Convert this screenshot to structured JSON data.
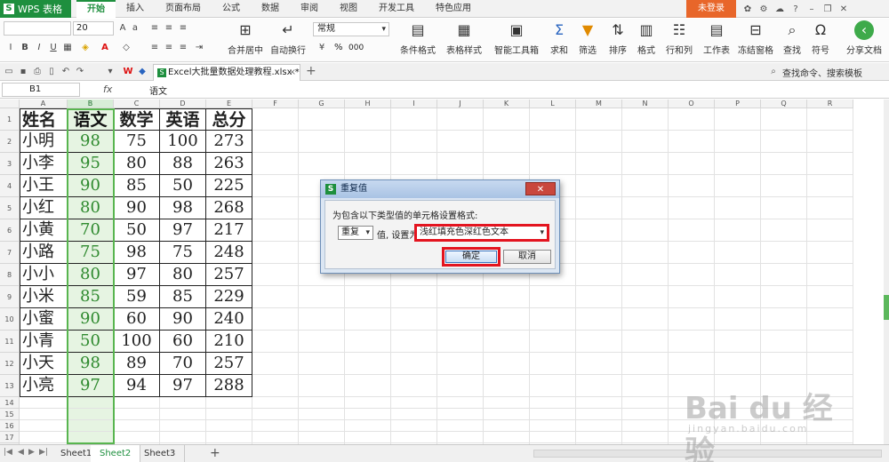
{
  "titlebar": {
    "app_name": "WPS 表格",
    "tabs": [
      "开始",
      "插入",
      "页面布局",
      "公式",
      "数据",
      "审阅",
      "视图",
      "开发工具",
      "特色应用"
    ],
    "active_tab": "开始",
    "login": "未登录"
  },
  "ribbon": {
    "font_name": "",
    "font_size": "20",
    "number_format": "常规",
    "merge_center": "合并居中",
    "auto_wrap": "自动换行",
    "percent": "%",
    "comma": "000",
    "cond_format": "条件格式",
    "table_style": "表格样式",
    "smart_toolbox": "智能工具箱",
    "sum": "求和",
    "filter": "筛选",
    "sort": "排序",
    "format": "格式",
    "row_col": "行和列",
    "worksheet": "工作表",
    "freeze": "冻结窗格",
    "find": "查找",
    "symbol": "符号",
    "share": "分享文档"
  },
  "doc_tab": {
    "filename": "Excel大批量数据处理教程.xlsx *",
    "search_placeholder": "查找命令、搜索模板"
  },
  "formula_bar": {
    "cell_ref": "B1",
    "fx": "fx",
    "value": "语文"
  },
  "grid": {
    "columns": [
      "A",
      "B",
      "C",
      "D",
      "E",
      "F",
      "G",
      "H",
      "I",
      "J",
      "K",
      "L",
      "M",
      "N",
      "O",
      "P",
      "Q",
      "R"
    ],
    "selected_column": "B",
    "row_numbers": [
      "1",
      "2",
      "3",
      "4",
      "5",
      "6",
      "7",
      "8",
      "9",
      "10",
      "11",
      "12",
      "13",
      "14",
      "15",
      "16",
      "17",
      "18"
    ],
    "headers": [
      "姓名",
      "语文",
      "数学",
      "英语",
      "总分"
    ],
    "rows": [
      [
        "小明",
        "98",
        "75",
        "100",
        "273"
      ],
      [
        "小李",
        "95",
        "80",
        "88",
        "263"
      ],
      [
        "小王",
        "90",
        "85",
        "50",
        "225"
      ],
      [
        "小红",
        "80",
        "90",
        "98",
        "268"
      ],
      [
        "小黄",
        "70",
        "50",
        "97",
        "217"
      ],
      [
        "小路",
        "75",
        "98",
        "75",
        "248"
      ],
      [
        "小小",
        "80",
        "97",
        "80",
        "257"
      ],
      [
        "小米",
        "85",
        "59",
        "85",
        "229"
      ],
      [
        "小蜜",
        "90",
        "60",
        "90",
        "240"
      ],
      [
        "小青",
        "50",
        "100",
        "60",
        "210"
      ],
      [
        "小天",
        "98",
        "89",
        "70",
        "257"
      ],
      [
        "小亮",
        "97",
        "94",
        "97",
        "288"
      ]
    ]
  },
  "sheets": {
    "tabs": [
      "Sheet1",
      "Sheet2",
      "Sheet3"
    ],
    "active": "Sheet2"
  },
  "dialog": {
    "title": "重复值",
    "prompt": "为包含以下类型值的单元格设置格式:",
    "type_value": "重复",
    "middle_text": "值, 设置为",
    "format_value": "浅红填充色深红色文本",
    "ok": "确定",
    "cancel": "取消"
  },
  "watermark": {
    "text": "Bai du 经验",
    "sub": "jingyan.baidu.com"
  }
}
